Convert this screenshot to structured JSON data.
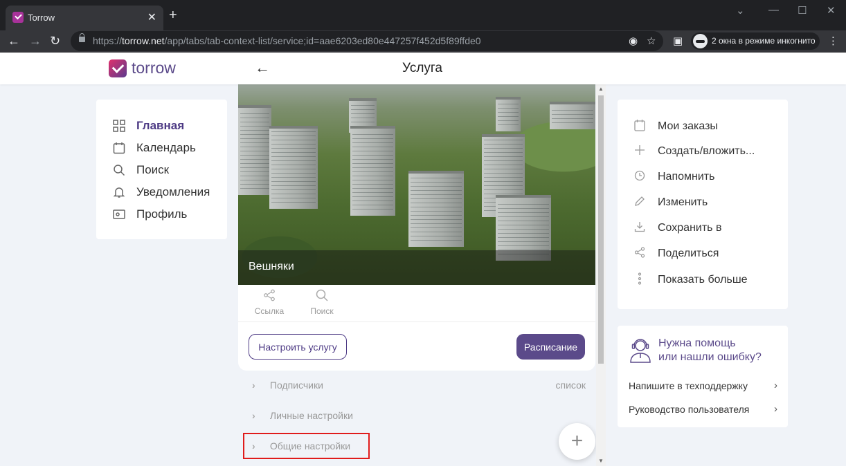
{
  "browser": {
    "tab_title": "Torrow",
    "tab_close": "✕",
    "new_tab": "+",
    "url_prefix": "https://",
    "url_host": "torrow.net",
    "url_path": "/app/tabs/tab-context-list/service;id=aae6203ed80e447257f452d5f89ffde0",
    "incognito_text": "2 окна в режиме инкогнито"
  },
  "header": {
    "logo_text": "torrow",
    "back": "←",
    "title": "Услуга"
  },
  "left_nav": {
    "items": [
      {
        "label": "Главная",
        "icon": "grid-icon",
        "active": true
      },
      {
        "label": "Календарь",
        "icon": "calendar-icon"
      },
      {
        "label": "Поиск",
        "icon": "search-icon"
      },
      {
        "label": "Уведомления",
        "icon": "bell-icon"
      },
      {
        "label": "Профиль",
        "icon": "profile-icon"
      }
    ]
  },
  "service": {
    "caption": "Вешняки",
    "actions": [
      {
        "label": "Ссылка",
        "icon": "share-icon"
      },
      {
        "label": "Поиск",
        "icon": "search-icon"
      }
    ],
    "configure_button": "Настроить услугу",
    "schedule_button": "Расписание",
    "rows": [
      {
        "label": "Подписчики",
        "right": "список"
      },
      {
        "label": "Личные настройки"
      },
      {
        "label": "Общие настройки"
      }
    ],
    "fab": "+"
  },
  "right_menu": {
    "items": [
      {
        "label": "Мои заказы",
        "icon": "orders-icon"
      },
      {
        "label": "Создать/вложить...",
        "icon": "plus-icon"
      },
      {
        "label": "Напомнить",
        "icon": "clock-icon"
      },
      {
        "label": "Изменить",
        "icon": "pencil-icon"
      },
      {
        "label": "Сохранить в",
        "icon": "download-icon"
      },
      {
        "label": "Поделиться",
        "icon": "share-icon"
      },
      {
        "label": "Показать больше",
        "icon": "more-vertical-icon"
      }
    ]
  },
  "help": {
    "title_line1": "Нужна помощь",
    "title_line2": "или нашли ошибку?",
    "links": [
      {
        "label": "Напишите в техподдержку"
      },
      {
        "label": "Руководство пользователя"
      }
    ]
  },
  "colors": {
    "brand": "#5b4a8a",
    "highlight": "#e01b1b"
  }
}
